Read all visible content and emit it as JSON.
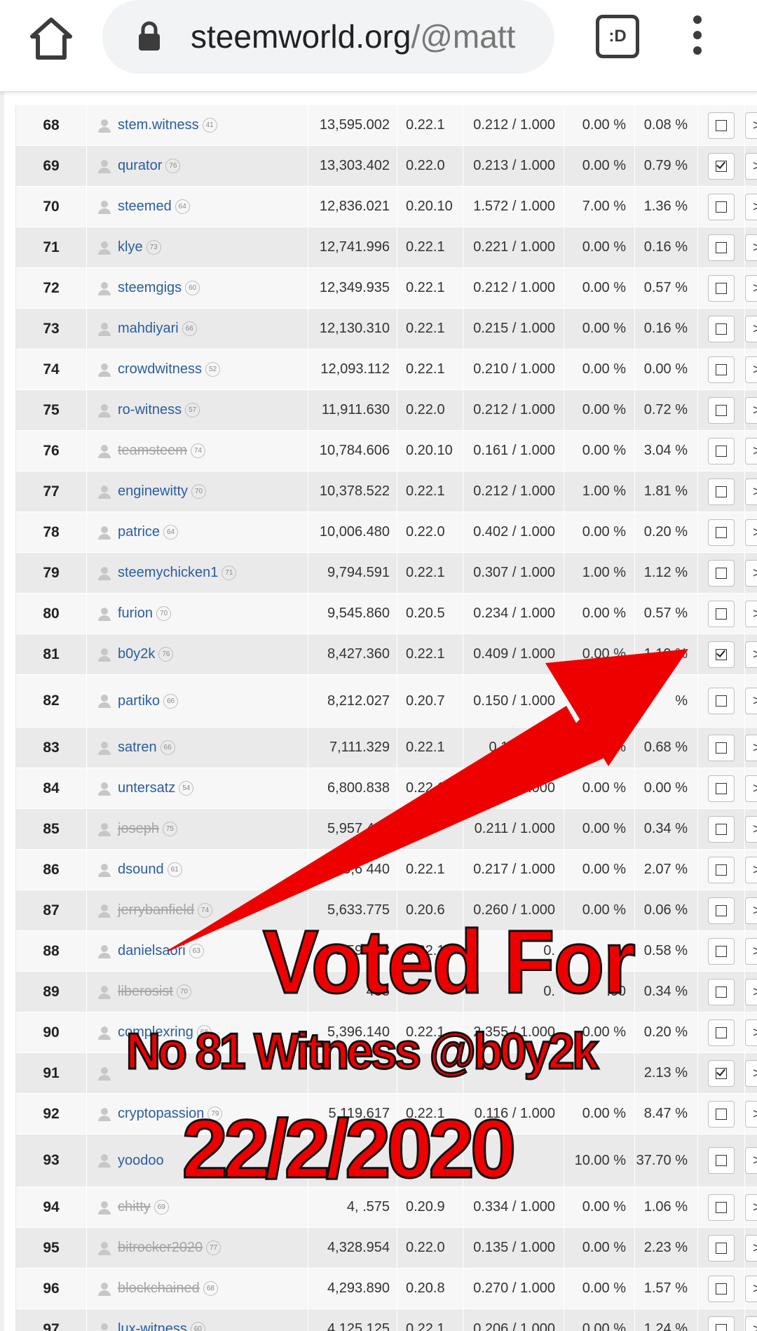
{
  "browser": {
    "url_host": "steemworld.org",
    "url_path": "/@matt",
    "tabs_label": ":D"
  },
  "witnesses": [
    {
      "rank": "68",
      "name": "stem.witness",
      "level": "41",
      "votes": "13,595.002",
      "version": "0.22.1",
      "feed": "0.212 / 1.000",
      "missed": "0.00 %",
      "pct": "0.08 %",
      "voted": false,
      "disabled": false
    },
    {
      "rank": "69",
      "name": "qurator",
      "level": "76",
      "votes": "13,303.402",
      "version": "0.22.0",
      "feed": "0.213 / 1.000",
      "missed": "0.00 %",
      "pct": "0.79 %",
      "voted": true,
      "disabled": false
    },
    {
      "rank": "70",
      "name": "steemed",
      "level": "64",
      "votes": "12,836.021",
      "version": "0.20.10",
      "feed": "1.572 / 1.000",
      "missed": "7.00 %",
      "pct": "1.36 %",
      "voted": false,
      "disabled": false
    },
    {
      "rank": "71",
      "name": "klye",
      "level": "73",
      "votes": "12,741.996",
      "version": "0.22.1",
      "feed": "0.221 / 1.000",
      "missed": "0.00 %",
      "pct": "0.16 %",
      "voted": false,
      "disabled": false
    },
    {
      "rank": "72",
      "name": "steemgigs",
      "level": "60",
      "votes": "12,349.935",
      "version": "0.22.1",
      "feed": "0.212 / 1.000",
      "missed": "0.00 %",
      "pct": "0.57 %",
      "voted": false,
      "disabled": false
    },
    {
      "rank": "73",
      "name": "mahdiyari",
      "level": "66",
      "votes": "12,130.310",
      "version": "0.22.1",
      "feed": "0.215 / 1.000",
      "missed": "0.00 %",
      "pct": "0.16 %",
      "voted": false,
      "disabled": false
    },
    {
      "rank": "74",
      "name": "crowdwitness",
      "level": "52",
      "votes": "12,093.112",
      "version": "0.22.1",
      "feed": "0.210 / 1.000",
      "missed": "0.00 %",
      "pct": "0.00 %",
      "voted": false,
      "disabled": false
    },
    {
      "rank": "75",
      "name": "ro-witness",
      "level": "57",
      "votes": "11,911.630",
      "version": "0.22.0",
      "feed": "0.212 / 1.000",
      "missed": "0.00 %",
      "pct": "0.72 %",
      "voted": false,
      "disabled": false
    },
    {
      "rank": "76",
      "name": "teamsteem",
      "level": "74",
      "votes": "10,784.606",
      "version": "0.20.10",
      "feed": "0.161 / 1.000",
      "missed": "0.00 %",
      "pct": "3.04 %",
      "voted": false,
      "disabled": true
    },
    {
      "rank": "77",
      "name": "enginewitty",
      "level": "70",
      "votes": "10,378.522",
      "version": "0.22.1",
      "feed": "0.212 / 1.000",
      "missed": "1.00 %",
      "pct": "1.81 %",
      "voted": false,
      "disabled": false
    },
    {
      "rank": "78",
      "name": "patrice",
      "level": "64",
      "votes": "10,006.480",
      "version": "0.22.0",
      "feed": "0.402 / 1.000",
      "missed": "0.00 %",
      "pct": "0.20 %",
      "voted": false,
      "disabled": false
    },
    {
      "rank": "79",
      "name": "steemychicken1",
      "level": "71",
      "votes": "9,794.591",
      "version": "0.22.1",
      "feed": "0.307 / 1.000",
      "missed": "1.00 %",
      "pct": "1.12 %",
      "voted": false,
      "disabled": false
    },
    {
      "rank": "80",
      "name": "furion",
      "level": "70",
      "votes": "9,545.860",
      "version": "0.20.5",
      "feed": "0.234 / 1.000",
      "missed": "0.00 %",
      "pct": "0.57 %",
      "voted": false,
      "disabled": false
    },
    {
      "rank": "81",
      "name": "b0y2k",
      "level": "76",
      "votes": "8,427.360",
      "version": "0.22.1",
      "feed": "0.409 / 1.000",
      "missed": "0.00 %",
      "pct": "1.19 %",
      "voted": true,
      "disabled": false
    },
    {
      "rank": "82",
      "name": "partiko",
      "level": "66",
      "votes": "8,212.027",
      "version": "0.20.7",
      "feed": "0.150 / 1.000",
      "missed": "0.",
      "pct": "%",
      "voted": false,
      "disabled": false,
      "tall": true
    },
    {
      "rank": "83",
      "name": "satren",
      "level": "66",
      "votes": "7,111.329",
      "version": "0.22.1",
      "feed": "0.174 / 1.0",
      "missed": ".00 %",
      "pct": "0.68 %",
      "voted": false,
      "disabled": false
    },
    {
      "rank": "84",
      "name": "untersatz",
      "level": "54",
      "votes": "6,800.838",
      "version": "0.22.1",
      "feed": "0.  / 1.000",
      "missed": "0.00 %",
      "pct": "0.00 %",
      "voted": false,
      "disabled": false
    },
    {
      "rank": "85",
      "name": "joseph",
      "level": "75",
      "votes": "5,957.495",
      "version": "0.",
      "feed": "0.211 / 1.000",
      "missed": "0.00 %",
      "pct": "0.34 %",
      "voted": false,
      "disabled": true
    },
    {
      "rank": "86",
      "name": "dsound",
      "level": "61",
      "votes": "5,6   440",
      "version": "0.22.1",
      "feed": "0.217 / 1.000",
      "missed": "0.00 %",
      "pct": "2.07 %",
      "voted": false,
      "disabled": false
    },
    {
      "rank": "87",
      "name": "jerrybanfield",
      "level": "74",
      "votes": "5,633.775",
      "version": "0.20.6",
      "feed": "0.260 / 1.000",
      "missed": "0.00 %",
      "pct": "0.06 %",
      "voted": false,
      "disabled": true
    },
    {
      "rank": "88",
      "name": "danielsaori",
      "level": "63",
      "votes": "5,594.08",
      "version": "0.22.1",
      "feed": "0.",
      "missed": "",
      "pct": "0.58 %",
      "voted": false,
      "disabled": false
    },
    {
      "rank": "89",
      "name": "liberosist",
      "level": "70",
      "votes": "435",
      "version": "",
      "feed": "0.",
      "missed": ".00",
      "pct": "0.34 %",
      "voted": false,
      "disabled": true
    },
    {
      "rank": "90",
      "name": "complexring",
      "level": "68",
      "votes": "5,396.140",
      "version": "0.22.1",
      "feed": "2.355 / 1.000",
      "missed": "0.00 %",
      "pct": "0.20 %",
      "voted": false,
      "disabled": false
    },
    {
      "rank": "91",
      "name": "",
      "level": "",
      "votes": "",
      "version": "",
      "feed": "",
      "missed": "",
      "pct": "2.13 %",
      "voted": true,
      "disabled": false
    },
    {
      "rank": "92",
      "name": "cryptopassion",
      "level": "79",
      "votes": "5,119.617",
      "version": "0.22.1",
      "feed": "0.116 / 1.000",
      "missed": "0.00 %",
      "pct": "8.47 %",
      "voted": false,
      "disabled": false
    },
    {
      "rank": "93",
      "name": "yoodoo",
      "level": "",
      "votes": "",
      "version": "",
      "feed": "",
      "missed": "10.00 %",
      "pct": "37.70 %",
      "voted": false,
      "disabled": false,
      "tall": true
    },
    {
      "rank": "94",
      "name": "chitty",
      "level": "69",
      "votes": "4,   .575",
      "version": "0.20.9",
      "feed": "0.334 / 1.000",
      "missed": "0.00 %",
      "pct": "1.06 %",
      "voted": false,
      "disabled": true
    },
    {
      "rank": "95",
      "name": "bitrocker2020",
      "level": "77",
      "votes": "4,328.954",
      "version": "0.22.0",
      "feed": "0.135 / 1.000",
      "missed": "0.00 %",
      "pct": "2.23 %",
      "voted": false,
      "disabled": true
    },
    {
      "rank": "96",
      "name": "blockchained",
      "level": "68",
      "votes": "4,293.890",
      "version": "0.20.8",
      "feed": "0.270 / 1.000",
      "missed": "0.00 %",
      "pct": "1.57 %",
      "voted": false,
      "disabled": true
    },
    {
      "rank": "97",
      "name": "lux-witness",
      "level": "60",
      "votes": "4,125.125",
      "version": "0.22.1",
      "feed": "0.206 / 1.000",
      "missed": "0.00 %",
      "pct": "1.24 %",
      "voted": false,
      "disabled": false
    }
  ],
  "more_label": ">",
  "overlay": {
    "line1": "Voted For",
    "line2": "No 81 Witness @b0y2k",
    "line3": "22/2/2020",
    "arrow_color": "#ee0000"
  }
}
